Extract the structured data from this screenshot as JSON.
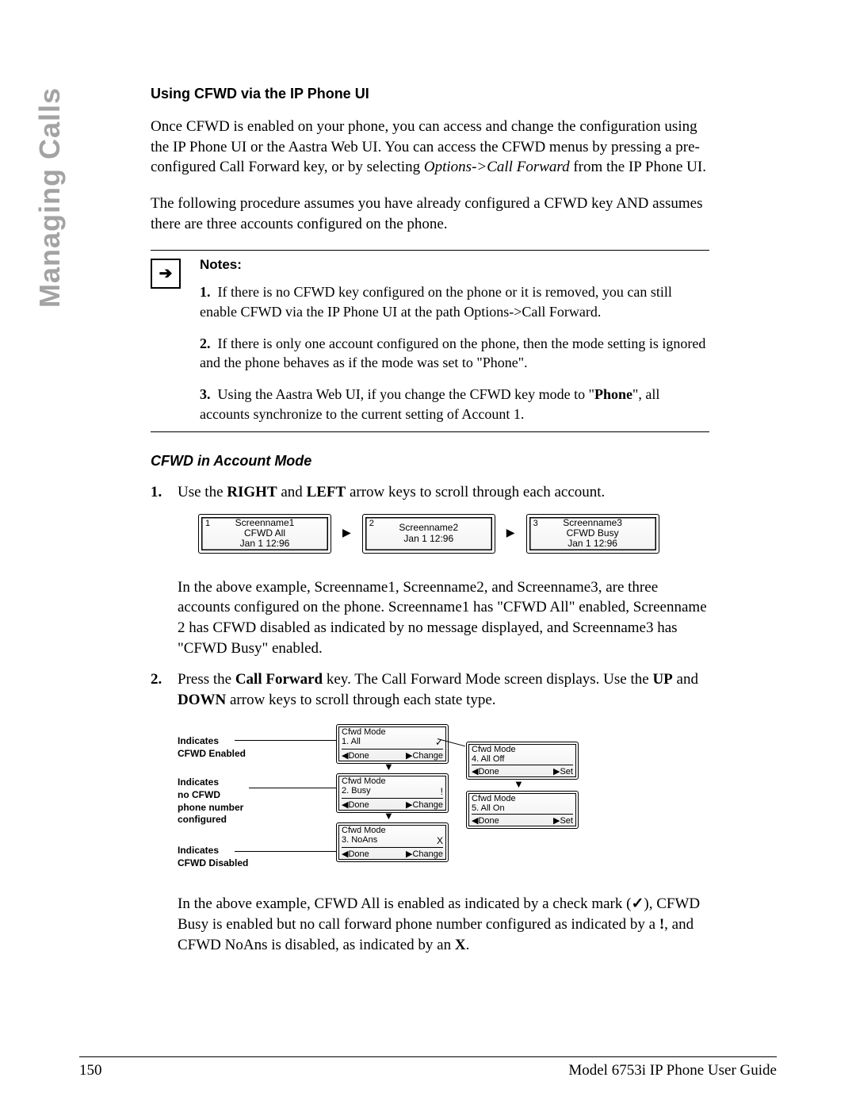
{
  "side_header": "Managing Calls",
  "section_title": "Using CFWD via the IP Phone UI",
  "para1_a": "Once CFWD is enabled on your phone, you can access and change the configuration using the IP Phone UI or the Aastra Web UI. You can access the CFWD menus by pressing a pre-configured Call Forward key, or by selecting ",
  "para1_italic": "Options->Call Forward",
  "para1_b": " from the IP Phone UI.",
  "para2": "The following procedure assumes you have already configured a CFWD key AND assumes there are three accounts configured on the phone.",
  "notes_title": "Notes:",
  "note1": "If there is no CFWD key configured on the phone or it is removed, you can still enable CFWD via the IP Phone UI at the path Options->Call Forward.",
  "note2": "If there is only one account configured on the phone, then the mode setting is ignored and the phone behaves as if the mode was set to \"Phone\".",
  "note3_a": "Using the Aastra Web UI, if you change the CFWD key mode to \"",
  "note3_bold": "Phone",
  "note3_b": "\", all accounts synchronize to the current setting of Account 1.",
  "subsection": "CFWD in Account Mode",
  "step1_a": "Use the ",
  "step1_b1": "RIGHT",
  "step1_mid": " and ",
  "step1_b2": "LEFT",
  "step1_c": " arrow keys to scroll through each account.",
  "screens": [
    {
      "num": "1",
      "name": "Screenname1",
      "status": "CFWD All",
      "time": "Jan 1 12:96"
    },
    {
      "num": "2",
      "name": "Screenname2",
      "status": "",
      "time": "Jan 1 12:96"
    },
    {
      "num": "3",
      "name": "Screenname3",
      "status": "CFWD Busy",
      "time": "Jan 1 12:96"
    }
  ],
  "step1_explain": "In the above example, Screenname1, Screenname2, and Screenname3, are three accounts configured on the phone. Screenname1 has \"CFWD All\" enabled, Screenname 2 has CFWD disabled as indicated by no message displayed, and Screenname3 has \"CFWD Busy\" enabled.",
  "step2_a": "Press the ",
  "step2_b1": "Call Forward",
  "step2_mid": " key. The Call Forward Mode screen displays. Use the ",
  "step2_b2": "UP",
  "step2_mid2": " and ",
  "step2_b3": "DOWN",
  "step2_c": " arrow keys to scroll through each state type.",
  "labels": {
    "enabled": "Indicates\nCFWD Enabled",
    "nonum": "Indicates\nno CFWD\nphone number\nconfigured",
    "disabled": "Indicates\nCFWD Disabled"
  },
  "mode_boxes": {
    "title": "Cfwd Mode",
    "all": {
      "item": "1. All",
      "sym": "✓",
      "left": "◀Done",
      "right": "▶Change"
    },
    "busy": {
      "item": "2. Busy",
      "sym": "!",
      "left": "◀Done",
      "right": "▶Change"
    },
    "noans": {
      "item": "3. NoAns",
      "sym": "X",
      "left": "◀Done",
      "right": "▶Change"
    },
    "alloff": {
      "item": "4. All Off",
      "sym": "",
      "left": "◀Done",
      "right": "▶Set"
    },
    "allon": {
      "item": "5. All On",
      "sym": "",
      "left": "◀Done",
      "right": "▶Set"
    }
  },
  "step2_explain_a": "In the above example, CFWD All is enabled as indicated by a check mark (",
  "step2_check": "✓",
  "step2_explain_b": "), CFWD Busy is enabled but no call forward phone number configured as indicated by a ",
  "step2_bang": "!",
  "step2_explain_c": ", and CFWD NoAns is disabled, as indicated by an ",
  "step2_x": "X",
  "step2_explain_d": ".",
  "footer_page": "150",
  "footer_title": "Model 6753i IP Phone User Guide"
}
